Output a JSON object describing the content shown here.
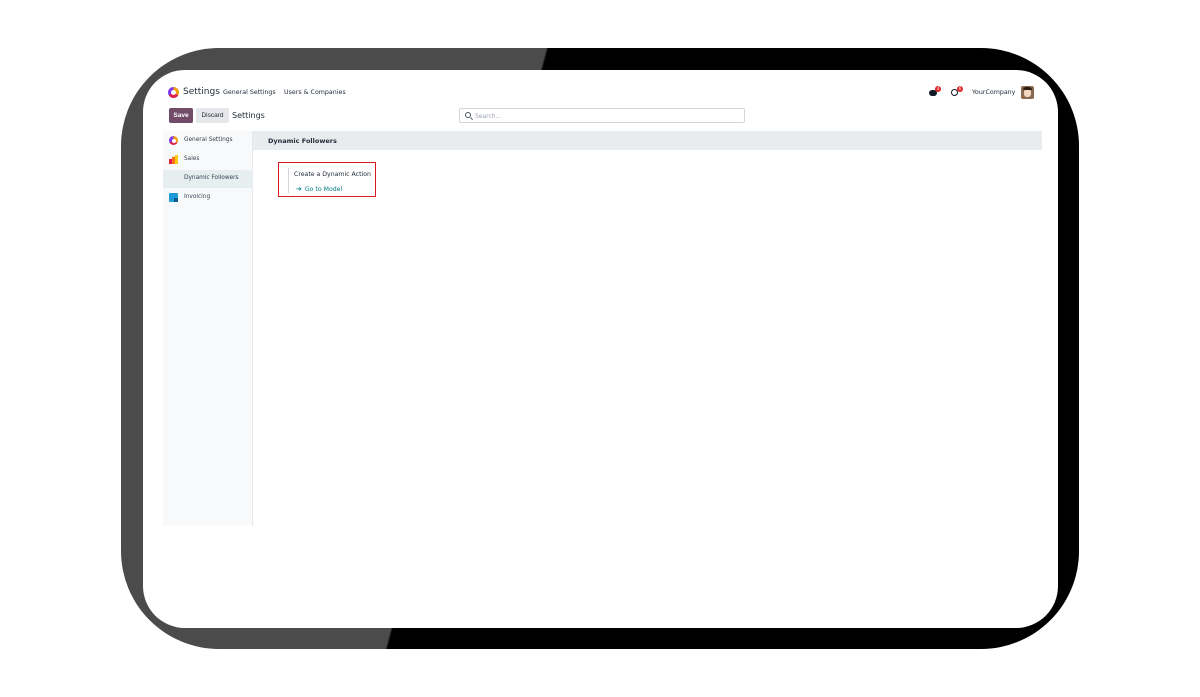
{
  "app": {
    "title": "Settings",
    "menu": [
      "General Settings",
      "Users & Companies"
    ]
  },
  "systray": {
    "chat_badge": "4",
    "activity_badge": "6",
    "company": "YourCompany"
  },
  "control_panel": {
    "save_label": "Save",
    "discard_label": "Discard",
    "breadcrumb": "Settings",
    "search_placeholder": "Search..."
  },
  "sidebar": {
    "items": [
      {
        "label": "General Settings",
        "icon": "general-settings-icon"
      },
      {
        "label": "Sales",
        "icon": "sales-icon"
      },
      {
        "label": "Dynamic Followers",
        "icon": ""
      },
      {
        "label": "Invoicing",
        "icon": "invoicing-icon"
      }
    ]
  },
  "main": {
    "section_title": "Dynamic Followers",
    "setting": {
      "title": "Create a Dynamic Action",
      "link_label": "Go to Model"
    }
  },
  "colors": {
    "primary": "#714b67",
    "link": "#017e84",
    "highlight_box": "#d71920"
  }
}
